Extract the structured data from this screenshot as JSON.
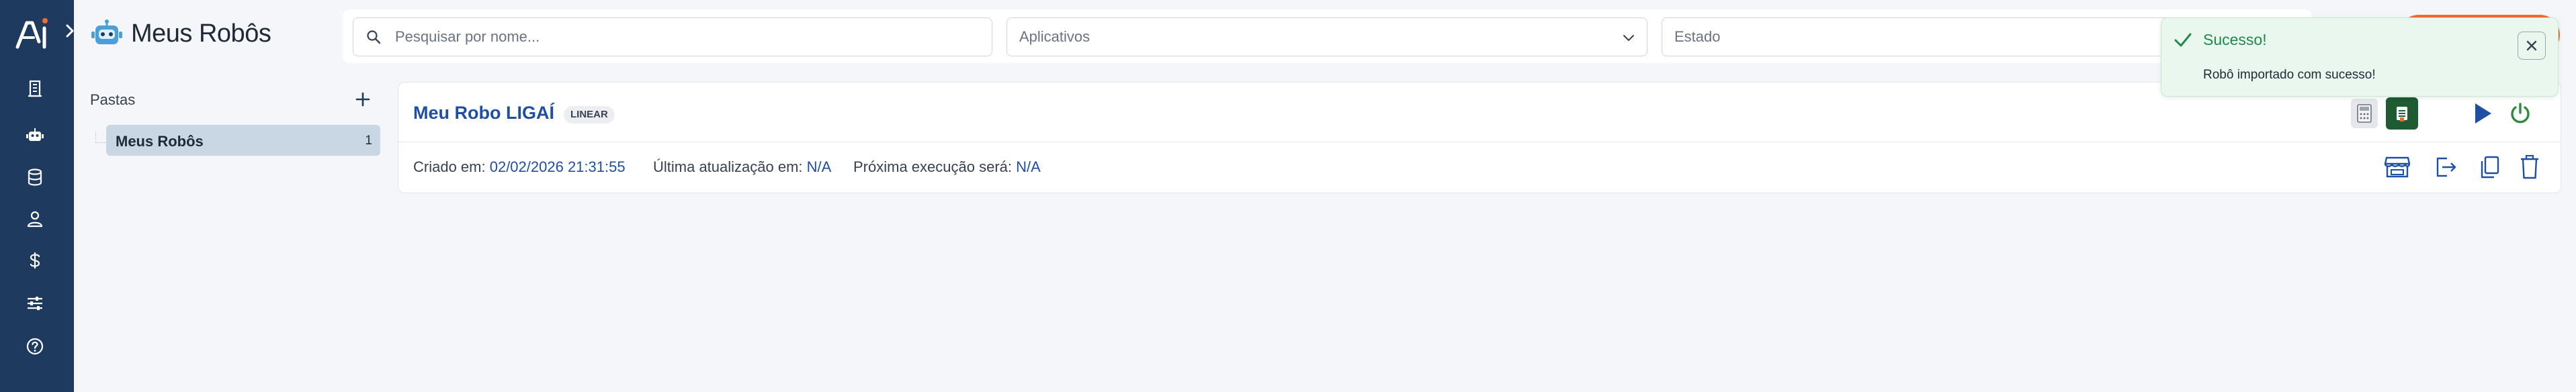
{
  "header": {
    "title": "Meus Robôs"
  },
  "filters": {
    "search_placeholder": "Pesquisar por nome...",
    "apps_label": "Aplicativos",
    "state_label": "Estado"
  },
  "folders": {
    "title": "Pastas",
    "items": [
      {
        "label": "Meus Robôs",
        "count": "1"
      }
    ]
  },
  "robot": {
    "name": "Meu Robo LIGAÍ",
    "badge": "LINEAR",
    "created_label": "Criado em:",
    "created_value": "02/02/2026 21:31:55",
    "updated_label": "Última atualização em:",
    "updated_value": "N/A",
    "next_label": "Próxima execução será:",
    "next_value": "N/A"
  },
  "toast": {
    "title": "Sucesso!",
    "message": "Robô importado com sucesso!"
  },
  "sidebar": {
    "icons": [
      "building-icon",
      "robot-icon",
      "database-icon",
      "user-icon",
      "dollar-icon",
      "sliders-icon",
      "help-icon"
    ]
  },
  "colors": {
    "sidebar": "#1f3a5f",
    "accent_blue": "#1e4fa3",
    "success_green": "#1f8a4c",
    "power_green": "#2e8b3e",
    "orange": "#f26a2e"
  }
}
